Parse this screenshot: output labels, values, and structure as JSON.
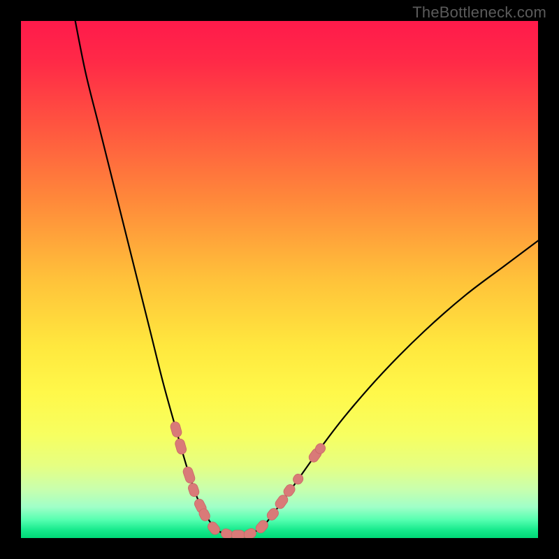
{
  "attribution": "TheBottleneck.com",
  "colors": {
    "frame": "#000000",
    "gradient_stops": [
      {
        "offset": 0.0,
        "color": "#ff1a4b"
      },
      {
        "offset": 0.08,
        "color": "#ff2a47"
      },
      {
        "offset": 0.2,
        "color": "#ff5440"
      },
      {
        "offset": 0.35,
        "color": "#ff8a3a"
      },
      {
        "offset": 0.5,
        "color": "#ffc23a"
      },
      {
        "offset": 0.63,
        "color": "#ffe83e"
      },
      {
        "offset": 0.72,
        "color": "#fff84a"
      },
      {
        "offset": 0.8,
        "color": "#f7ff60"
      },
      {
        "offset": 0.86,
        "color": "#e6ff82"
      },
      {
        "offset": 0.905,
        "color": "#c9ffad"
      },
      {
        "offset": 0.94,
        "color": "#a0ffc8"
      },
      {
        "offset": 0.965,
        "color": "#55ffb0"
      },
      {
        "offset": 0.985,
        "color": "#15e98b"
      },
      {
        "offset": 1.0,
        "color": "#00d977"
      }
    ],
    "curve_stroke": "#000000",
    "marker_fill": "#d97a78",
    "marker_stroke": "#c86866"
  },
  "chart_data": {
    "type": "line",
    "title": "",
    "xlabel": "",
    "ylabel": "",
    "xlim": [
      0,
      100
    ],
    "ylim": [
      0,
      100
    ],
    "grid": false,
    "curve_left": [
      {
        "x": 10.5,
        "y": 100
      },
      {
        "x": 12.5,
        "y": 90
      },
      {
        "x": 15.0,
        "y": 80
      },
      {
        "x": 17.5,
        "y": 70
      },
      {
        "x": 20.0,
        "y": 60
      },
      {
        "x": 22.5,
        "y": 50
      },
      {
        "x": 25.0,
        "y": 40
      },
      {
        "x": 27.5,
        "y": 30
      },
      {
        "x": 30.0,
        "y": 21
      },
      {
        "x": 32.0,
        "y": 14
      },
      {
        "x": 34.0,
        "y": 8
      },
      {
        "x": 36.0,
        "y": 4
      },
      {
        "x": 38.0,
        "y": 1.5
      },
      {
        "x": 40.0,
        "y": 0.7
      }
    ],
    "curve_right": [
      {
        "x": 44.0,
        "y": 0.7
      },
      {
        "x": 46.5,
        "y": 2.0
      },
      {
        "x": 49.0,
        "y": 5.0
      },
      {
        "x": 53.0,
        "y": 10.5
      },
      {
        "x": 58.0,
        "y": 17.5
      },
      {
        "x": 63.0,
        "y": 24.0
      },
      {
        "x": 70.0,
        "y": 32.0
      },
      {
        "x": 78.0,
        "y": 40.0
      },
      {
        "x": 86.0,
        "y": 47.0
      },
      {
        "x": 94.0,
        "y": 53.0
      },
      {
        "x": 100.0,
        "y": 57.5
      }
    ],
    "flat_segment": {
      "x0": 40.0,
      "x1": 44.0,
      "y": 0.7
    },
    "markers": [
      {
        "x": 30.0,
        "y": 21.0,
        "len": 3.0
      },
      {
        "x": 30.9,
        "y": 17.7,
        "len": 3.0
      },
      {
        "x": 32.5,
        "y": 12.2,
        "len": 3.2
      },
      {
        "x": 33.4,
        "y": 9.3,
        "len": 2.6
      },
      {
        "x": 34.7,
        "y": 6.2,
        "len": 2.8
      },
      {
        "x": 35.5,
        "y": 4.5,
        "len": 2.4
      },
      {
        "x": 37.3,
        "y": 1.9,
        "len": 2.6
      },
      {
        "x": 39.8,
        "y": 0.8,
        "len": 2.2
      },
      {
        "x": 42.0,
        "y": 0.6,
        "len": 2.6
      },
      {
        "x": 44.3,
        "y": 0.8,
        "len": 2.4
      },
      {
        "x": 46.6,
        "y": 2.2,
        "len": 2.6
      },
      {
        "x": 48.7,
        "y": 4.6,
        "len": 2.4
      },
      {
        "x": 50.4,
        "y": 7.0,
        "len": 2.8
      },
      {
        "x": 51.9,
        "y": 9.2,
        "len": 2.4
      },
      {
        "x": 53.6,
        "y": 11.4,
        "len": 2.0
      },
      {
        "x": 56.9,
        "y": 16.0,
        "len": 2.8
      },
      {
        "x": 57.9,
        "y": 17.3,
        "len": 2.0
      }
    ]
  }
}
